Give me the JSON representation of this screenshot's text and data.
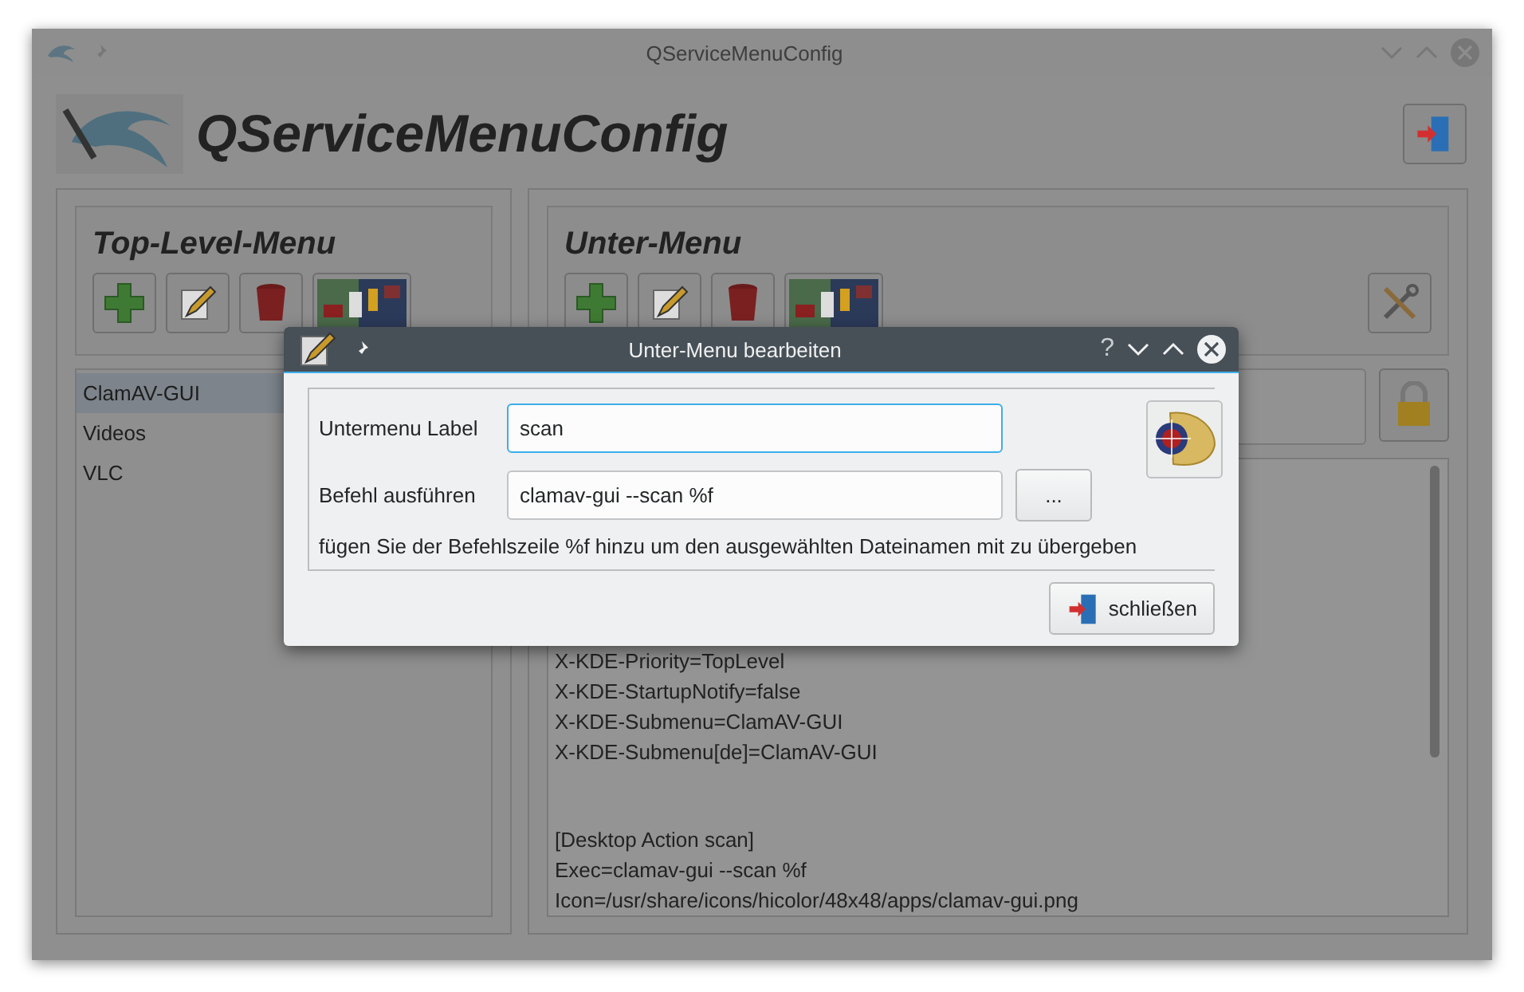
{
  "window": {
    "title": "QServiceMenuConfig"
  },
  "app_title": "QServiceMenuConfig",
  "top_level_menu": {
    "title": "Top-Level-Menu",
    "items": [
      {
        "label": "ClamAV-GUI",
        "selected": true
      },
      {
        "label": "Videos",
        "selected": false
      },
      {
        "label": "VLC",
        "selected": false
      }
    ]
  },
  "sub_menu": {
    "title": "Unter-Menu",
    "text_blocks": [
      {
        "lines": [
          "X-KDE-Priority=TopLevel",
          "X-KDE-StartupNotify=false",
          "X-KDE-Submenu=ClamAV-GUI",
          "X-KDE-Submenu[de]=ClamAV-GUI"
        ]
      },
      {
        "lines": [
          "[Desktop Action scan]",
          "Exec=clamav-gui --scan %f",
          "Icon=/usr/share/icons/hicolor/48x48/apps/clamav-gui.png"
        ]
      }
    ]
  },
  "dialog": {
    "title": "Unter-Menu bearbeiten",
    "help": "?",
    "fields": [
      {
        "label": "Untermenu Label",
        "value": "scan",
        "focused": true
      },
      {
        "label": "Befehl ausführen",
        "value": "clamav-gui --scan %f",
        "focused": false
      }
    ],
    "browse_button": "...",
    "hint": "fügen Sie der Befehlszeile %f hinzu um den ausgewählten Dateinamen mit zu übergeben",
    "close_button": "schließen"
  }
}
